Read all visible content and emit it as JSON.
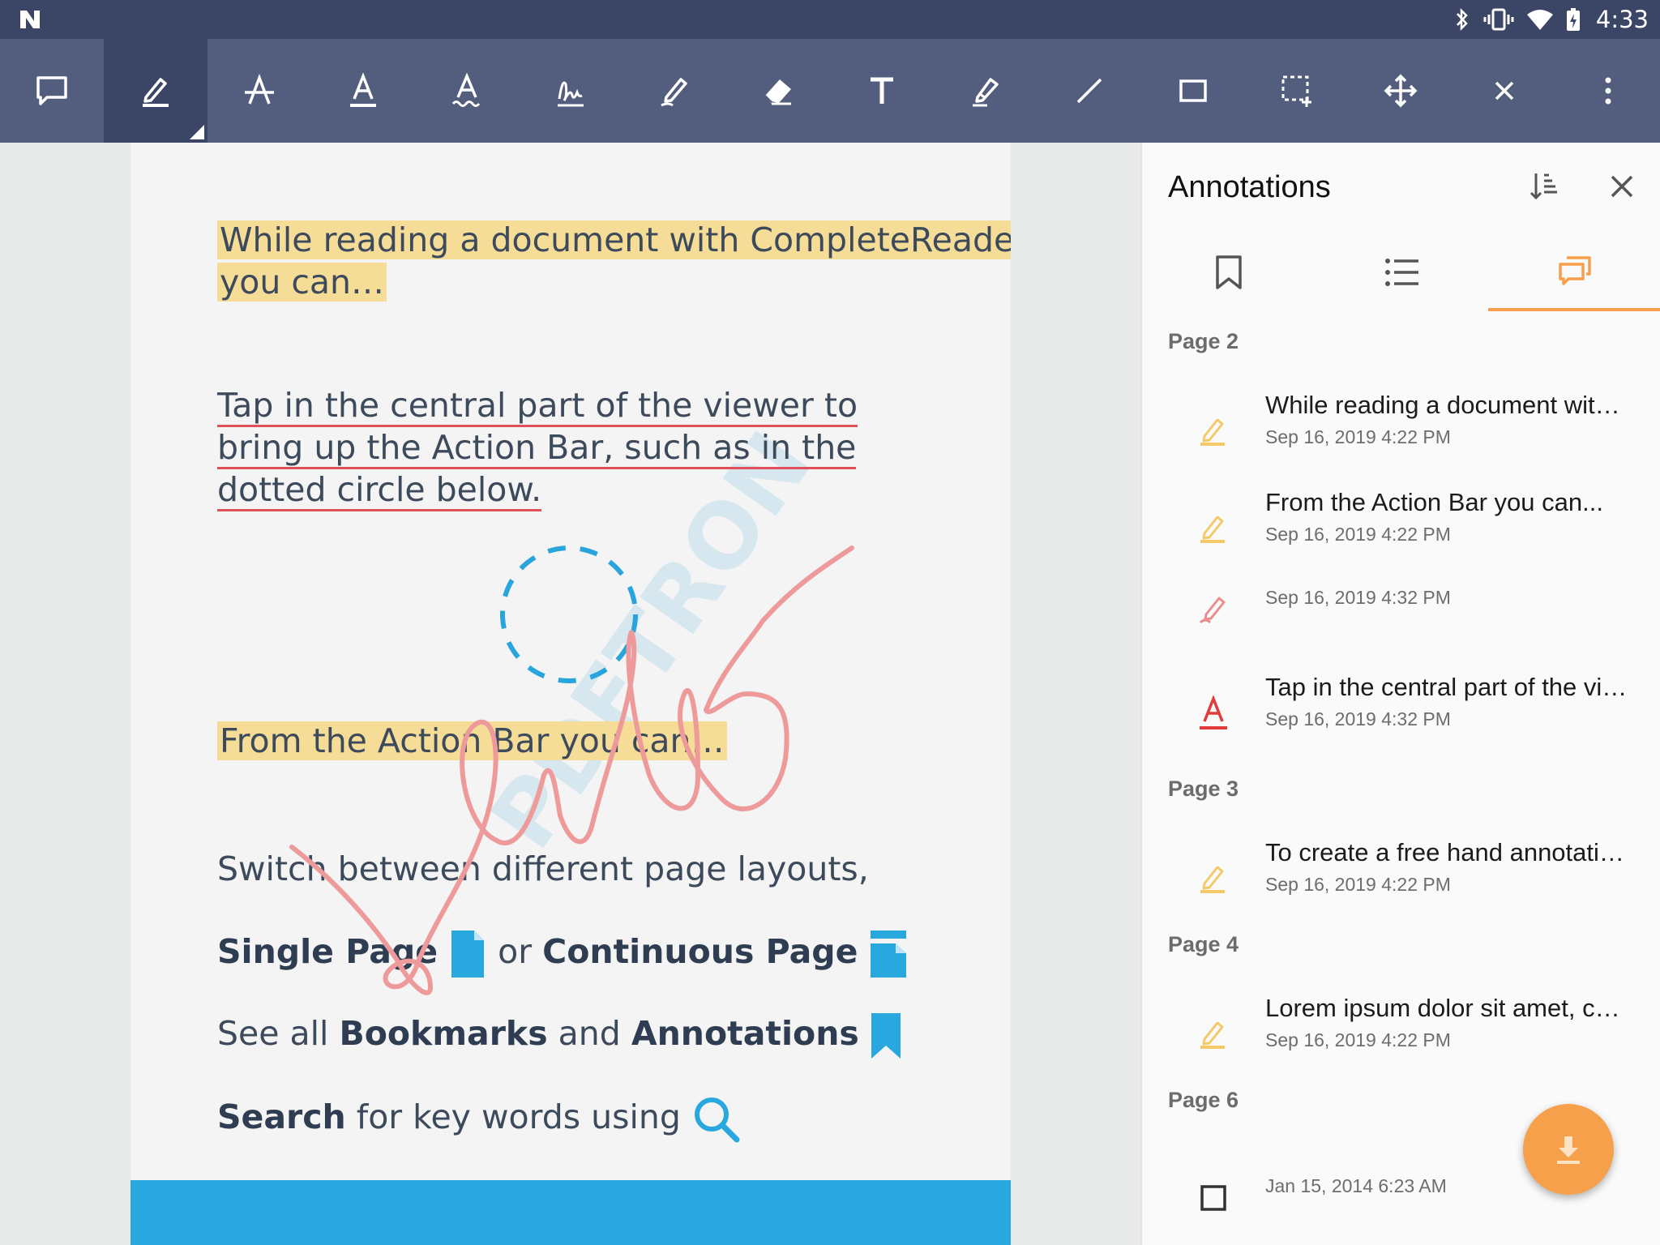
{
  "status_bar": {
    "time": "4:33"
  },
  "toolbar": {
    "tools": [
      {
        "name": "comment-tool",
        "icon": "comment-icon"
      },
      {
        "name": "highlight-tool",
        "icon": "highlighter-icon",
        "active": true
      },
      {
        "name": "strikeout-tool",
        "icon": "strikeout-icon"
      },
      {
        "name": "underline-tool",
        "icon": "underline-icon"
      },
      {
        "name": "squiggly-tool",
        "icon": "squiggly-icon"
      },
      {
        "name": "signature-tool",
        "icon": "signature-icon"
      },
      {
        "name": "freehand-tool",
        "icon": "pen-icon"
      },
      {
        "name": "eraser-tool",
        "icon": "eraser-icon"
      },
      {
        "name": "freetext-tool",
        "icon": "text-icon"
      },
      {
        "name": "freehand-highlight-tool",
        "icon": "marker-icon"
      },
      {
        "name": "line-tool",
        "icon": "line-icon"
      },
      {
        "name": "rectangle-tool",
        "icon": "rectangle-icon"
      },
      {
        "name": "select-area-tool",
        "icon": "dashed-select-icon"
      },
      {
        "name": "pan-tool",
        "icon": "move-icon"
      },
      {
        "name": "close-toolbar",
        "icon": "close-icon"
      },
      {
        "name": "overflow-menu",
        "icon": "more-vertical-icon"
      }
    ]
  },
  "document": {
    "para1_line1": "While reading a document with CompleteReader",
    "para1_line2": "you can…",
    "para2_line1": "Tap in the central part of the viewer to",
    "para2_line2": "bring up the Action Bar, such as in the",
    "para2_line3": "dotted circle below.",
    "para3": "From the Action Bar you can…",
    "para4": "Switch between different page layouts,",
    "para5_bold1": "Single Page",
    "para5_mid": "or",
    "para5_bold2": "Continuous Page",
    "para6_pre": "See all",
    "para6_bold1": "Bookmarks",
    "para6_mid": "and",
    "para6_bold2": "Annotations",
    "para7_bold": "Search",
    "para7_rest": "for key words using",
    "watermark": "PDFTRON"
  },
  "panel": {
    "title": "Annotations",
    "tabs": [
      {
        "name": "bookmarks",
        "icon": "bookmark-icon"
      },
      {
        "name": "outline",
        "icon": "list-icon"
      },
      {
        "name": "annotations",
        "icon": "annotations-icon",
        "active": true
      }
    ],
    "sections": [
      {
        "label": "Page 2"
      },
      {
        "label": "Page 3"
      },
      {
        "label": "Page 4"
      },
      {
        "label": "Page 6"
      }
    ],
    "annotations": [
      {
        "title": "While reading a document wit…",
        "date": "Sep 16, 2019 4:22 PM",
        "icon": "highlighter-icon"
      },
      {
        "title": "From the Action Bar you can...",
        "date": "Sep 16, 2019 4:22 PM",
        "icon": "highlighter-icon"
      },
      {
        "title": "",
        "date": "Sep 16, 2019 4:32 PM",
        "icon": "ink-pen-icon"
      },
      {
        "title": "Tap in the central part of the vi…",
        "date": "Sep 16, 2019 4:32 PM",
        "icon": "underline-icon"
      },
      {
        "title": "To create a free hand annotati…",
        "date": "Sep 16, 2019 4:22 PM",
        "icon": "highlighter-icon"
      },
      {
        "title": "Lorem ipsum dolor sit amet, c…",
        "date": "Sep 16, 2019 4:22 PM",
        "icon": "highlighter-icon"
      },
      {
        "title": "",
        "date": "Jan 15, 2014 6:23 AM",
        "icon": "square-icon"
      }
    ]
  },
  "colors": {
    "status_bar": "#3b4566",
    "toolbar": "#535d7e",
    "highlight": "#f5dc97",
    "underline": "#e0505a",
    "ink": "#ee9a9a",
    "accent_blue": "#29a8df",
    "accent_orange": "#f7a04b"
  }
}
